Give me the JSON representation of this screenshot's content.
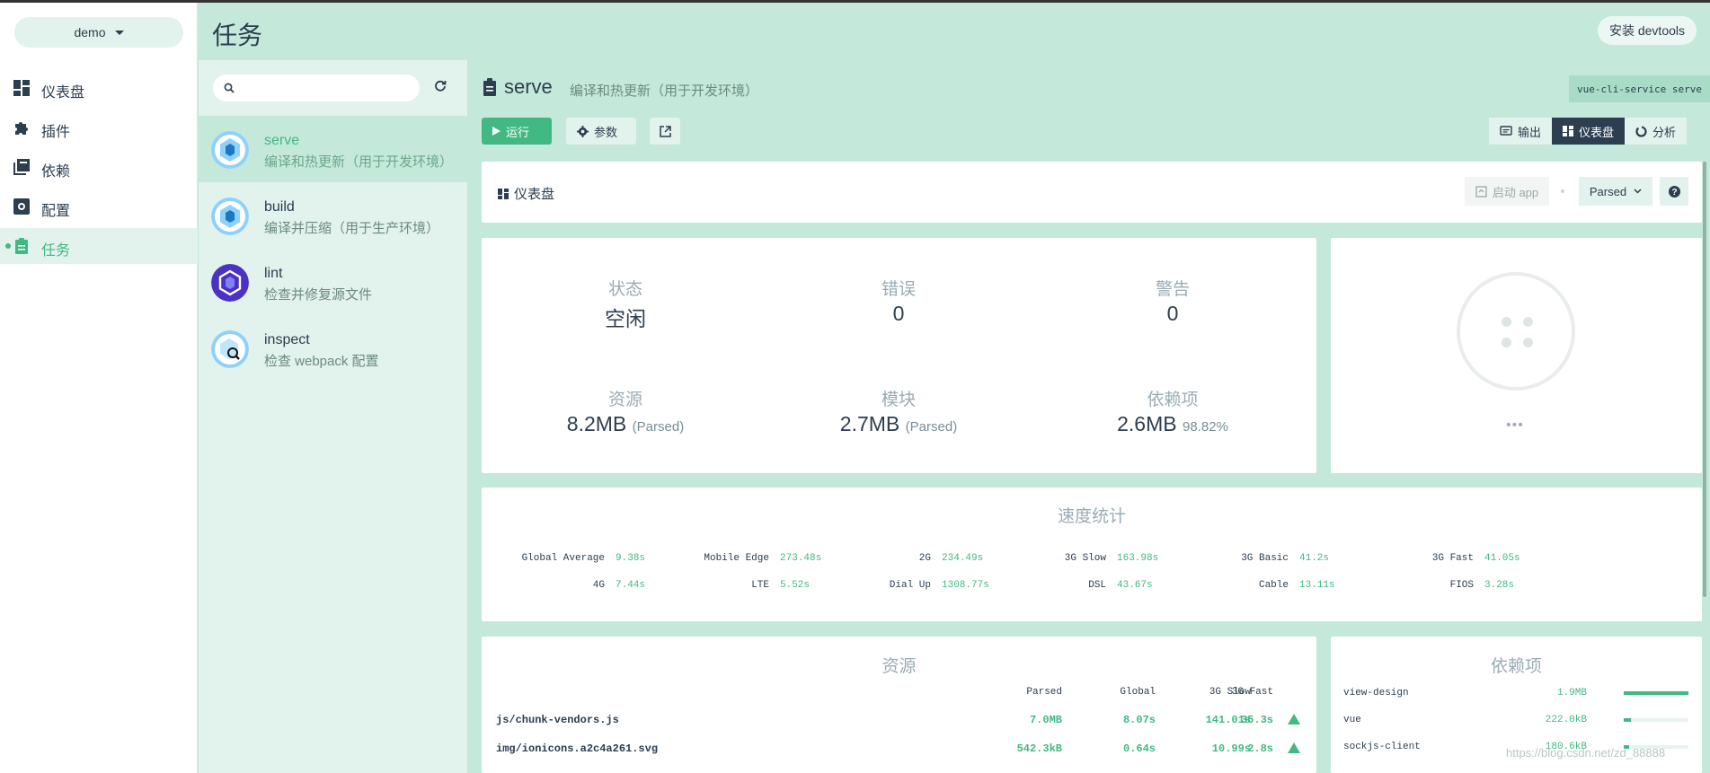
{
  "nav": {
    "project": "demo",
    "items": [
      {
        "label": "仪表盘",
        "icon": "dashboard-icon"
      },
      {
        "label": "插件",
        "icon": "puzzle-icon"
      },
      {
        "label": "依赖",
        "icon": "library-icon"
      },
      {
        "label": "配置",
        "icon": "settings-icon"
      },
      {
        "label": "任务",
        "icon": "clipboard-icon",
        "active": true
      }
    ]
  },
  "header": {
    "title": "任务",
    "devtools": "安装 devtools"
  },
  "tasks": [
    {
      "name": "serve",
      "desc": "编译和热更新（用于开发环境）",
      "active": true
    },
    {
      "name": "build",
      "desc": "编译并压缩（用于生产环境）"
    },
    {
      "name": "lint",
      "desc": "检查并修复源文件"
    },
    {
      "name": "inspect",
      "desc": "检查 webpack 配置"
    }
  ],
  "main": {
    "title": "serve",
    "desc": "编译和热更新（用于开发环境）",
    "command": "vue-cli-service serve",
    "run": "运行",
    "params": "参数",
    "tabs": [
      "输出",
      "仪表盘",
      "分析"
    ],
    "active_tab": "仪表盘"
  },
  "dashboard": {
    "title": "仪表盘",
    "launch_app": "启动 app",
    "size_mode": "Parsed",
    "stats": [
      {
        "label": "状态",
        "value": "空闲",
        "extra": ""
      },
      {
        "label": "错误",
        "value": "0",
        "extra": ""
      },
      {
        "label": "警告",
        "value": "0",
        "extra": ""
      },
      {
        "label": "资源",
        "value": "8.2MB",
        "extra": "(Parsed)"
      },
      {
        "label": "模块",
        "value": "2.7MB",
        "extra": "(Parsed)"
      },
      {
        "label": "依赖项",
        "value": "2.6MB",
        "extra": "98.82%"
      }
    ],
    "avatar_dots": "•••"
  },
  "speed": {
    "title": "速度统计",
    "row1": [
      {
        "name": "Global Average",
        "value": "9.38s"
      },
      {
        "name": "Mobile Edge",
        "value": "273.48s"
      },
      {
        "name": "2G",
        "value": "234.49s"
      },
      {
        "name": "3G Slow",
        "value": "163.98s"
      },
      {
        "name": "3G Basic",
        "value": "41.2s"
      },
      {
        "name": "3G Fast",
        "value": "41.05s"
      }
    ],
    "row2": [
      {
        "name": "4G",
        "value": "7.44s"
      },
      {
        "name": "LTE",
        "value": "5.52s"
      },
      {
        "name": "Dial Up",
        "value": "1308.77s"
      },
      {
        "name": "DSL",
        "value": "43.67s"
      },
      {
        "name": "Cable",
        "value": "13.11s"
      },
      {
        "name": "FIOS",
        "value": "3.28s"
      }
    ]
  },
  "assets": {
    "title": "资源",
    "columns": [
      "Parsed",
      "Global",
      "3G Slow",
      "3G Fast"
    ],
    "rows": [
      {
        "file": "js/chunk-vendors.js",
        "cells": [
          "7.0MB",
          "8.07s",
          "141.01s",
          "35.3s"
        ]
      },
      {
        "file": "img/ionicons.a2c4a261.svg",
        "cells": [
          "542.3kB",
          "0.64s",
          "10.99s",
          "2.8s"
        ]
      }
    ]
  },
  "deps": {
    "title": "依赖项",
    "rows": [
      {
        "name": "view-design",
        "size": "1.9MB",
        "fraction": 1.0
      },
      {
        "name": "vue",
        "size": "222.0kB",
        "fraction": 0.11
      },
      {
        "name": "sockjs-client",
        "size": "180.6kB",
        "fraction": 0.09
      }
    ]
  },
  "watermark": "https://blog.csdn.net/zd_88888"
}
